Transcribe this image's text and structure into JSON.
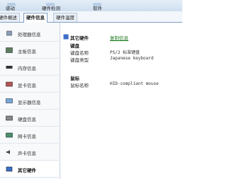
{
  "toolbar": {
    "buttons": [
      "驱动",
      "硬件检测",
      "软件"
    ]
  },
  "tabs": [
    "硬件概述",
    "硬件信息",
    "硬件温度"
  ],
  "sidebar": {
    "items": [
      "处理器信息",
      "主板信息",
      "内存信息",
      "显卡信息",
      "显示器信息",
      "硬盘信息",
      "网卡信息",
      "声卡信息",
      "其它硬件"
    ]
  },
  "content": {
    "section_title": "其它硬件",
    "copy_link": "复制信息",
    "keyboard": {
      "group": "键盘",
      "name_label": "键盘名称",
      "name_value": "PS/2 标准键盘",
      "type_label": "键盘类型",
      "type_value": "Japanese keyboard"
    },
    "mouse": {
      "group": "鼠标",
      "name_label": "鼠标名称",
      "name_value": "HID-compliant mouse"
    }
  }
}
